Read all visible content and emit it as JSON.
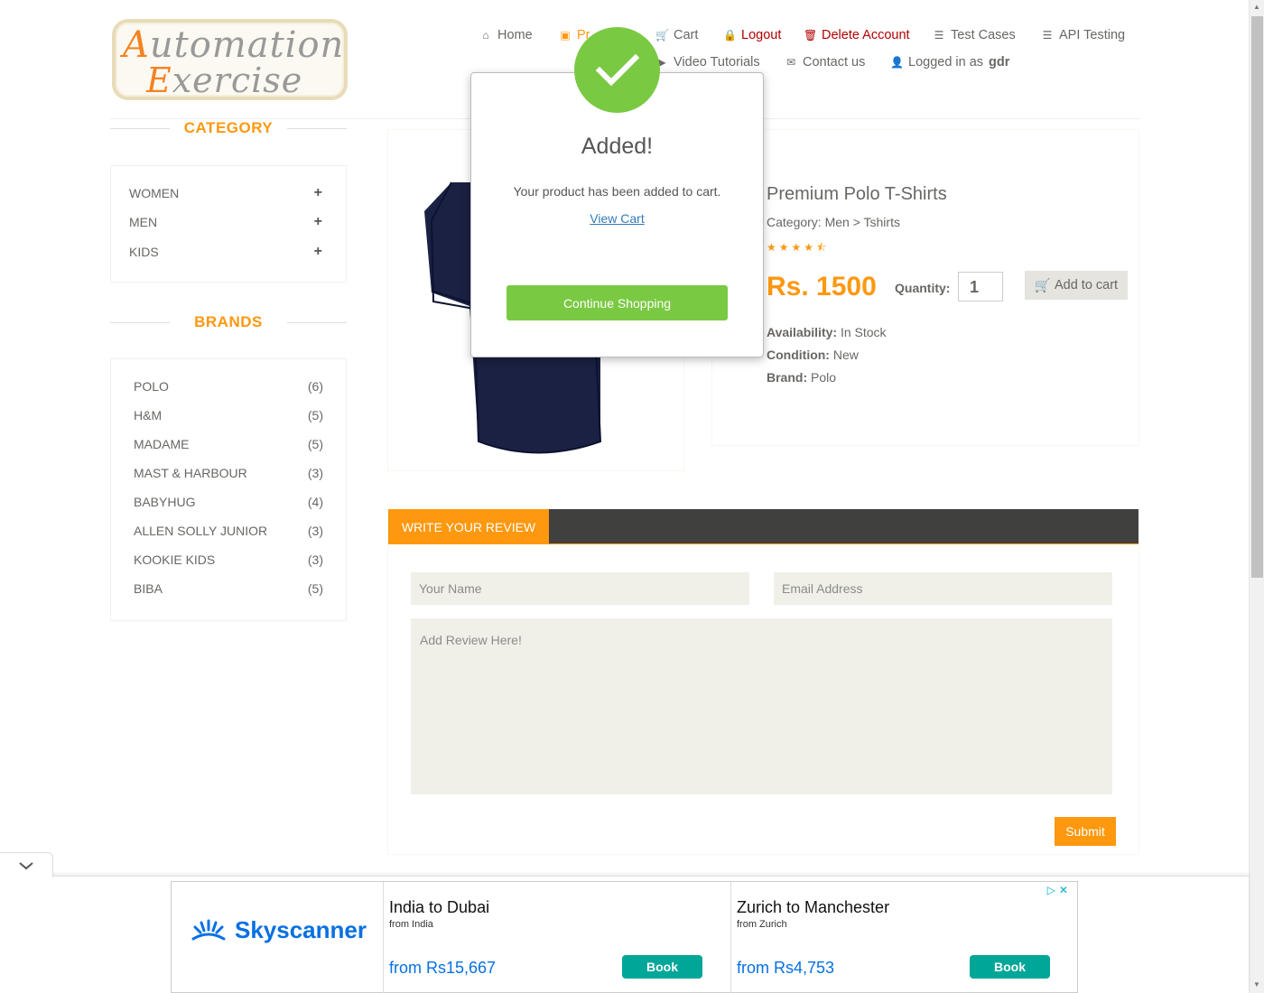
{
  "logo": {
    "line1_cap": "A",
    "line1_rest": "utomation",
    "line2_cap": "E",
    "line2_rest": "xercise"
  },
  "nav": {
    "home": "Home",
    "products": "Pr",
    "cart": "Cart",
    "logout": "Logout",
    "delete_account": "Delete Account",
    "test_cases": "Test Cases",
    "api_testing": "API Testing",
    "video_tutorials": "Video Tutorials",
    "contact_us": "Contact us",
    "logged_in_prefix": "Logged in as",
    "username": "gdr"
  },
  "sidebar": {
    "category_title": "CATEGORY",
    "categories": [
      "WOMEN",
      "MEN",
      "KIDS"
    ],
    "brands_title": "BRANDS",
    "brands": [
      {
        "name": "POLO",
        "count": "(6)"
      },
      {
        "name": "H&M",
        "count": "(5)"
      },
      {
        "name": "MADAME",
        "count": "(5)"
      },
      {
        "name": "MAST & HARBOUR",
        "count": "(3)"
      },
      {
        "name": "BABYHUG",
        "count": "(4)"
      },
      {
        "name": "ALLEN SOLLY JUNIOR",
        "count": "(3)"
      },
      {
        "name": "KOOKIE KIDS",
        "count": "(3)"
      },
      {
        "name": "BIBA",
        "count": "(5)"
      }
    ]
  },
  "product": {
    "title": "Premium Polo T-Shirts",
    "category": "Category: Men > Tshirts",
    "rating": 4.5,
    "price": "Rs. 1500",
    "quantity_label": "Quantity:",
    "quantity": "1",
    "add_to_cart": "Add to cart",
    "availability_label": "Availability:",
    "availability": "In Stock",
    "condition_label": "Condition:",
    "condition": "New",
    "brand_label": "Brand:",
    "brand": "Polo"
  },
  "review": {
    "tab": "WRITE YOUR REVIEW",
    "name_placeholder": "Your Name",
    "email_placeholder": "Email Address",
    "review_placeholder": "Add Review Here!",
    "submit": "Submit"
  },
  "modal": {
    "title": "Added!",
    "message": "Your product has been added to cart.",
    "view_cart": "View Cart",
    "continue": "Continue Shopping"
  },
  "ad": {
    "brand": "Skyscanner",
    "offers": [
      {
        "dest": "India to Dubai",
        "from": "from India",
        "price": "from Rs15,667",
        "book": "Book"
      },
      {
        "dest": "Zurich to Manchester",
        "from": "from Zurich",
        "price": "from Rs4,753",
        "book": "Book"
      }
    ]
  },
  "colors": {
    "accent": "#fe980f",
    "success": "#7ac943",
    "danger": "#b20000",
    "link": "#337ab7",
    "skyscanner": "#0770e3",
    "book": "#00a698"
  }
}
